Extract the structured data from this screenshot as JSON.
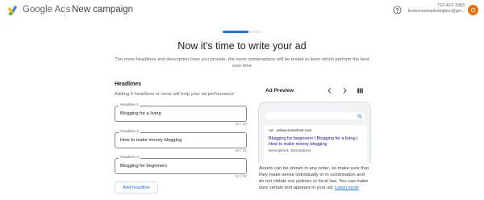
{
  "header": {
    "brand": "Google Ads",
    "title": "New campaign",
    "account_phone": "722-423-1083",
    "account_email": "bestschoolmarketingben@gm...",
    "avatar_letter": "O",
    "icons": {
      "logo": "google-ads-logo",
      "help": "help-icon"
    }
  },
  "progress": {
    "step": 2,
    "total": 3,
    "fraction": 0.66
  },
  "page": {
    "title": "Now it's time to write your ad",
    "subtitle": "The more headlines and description lines you provide, the more combinations will be tested to learn which perform the best over time"
  },
  "headlines": {
    "section_title": "Headlines",
    "hint": "Adding 3 headlines or more will help your ad performance",
    "items": [
      {
        "label": "Headline 1",
        "value": "Blogging for a living",
        "count": "21 / 30"
      },
      {
        "label": "Headline 2",
        "value": "How to make money blogging",
        "count": "26 / 30"
      },
      {
        "label": "Headline 3",
        "value": "Blogging for beginners",
        "count": "22 / 30"
      }
    ],
    "add_label": "Add headline"
  },
  "preview": {
    "title": "Ad Preview",
    "ad_url": "Ad · onlinecoursehost.com",
    "ad_headline": "Blogging for beginners | Blogging for a living | How to make money blogging",
    "ad_description": "Description1. Description2",
    "note_text": "Assets can be shown in any order, so make sure that they make sense individually or in combination and do not violate our policies or local law. You can make sure certain text appears in your ad.",
    "note_link": "Learn more"
  },
  "colors": {
    "accent": "#1a73e8",
    "avatar": "#e8710a",
    "ad_link": "#1a0dab"
  }
}
